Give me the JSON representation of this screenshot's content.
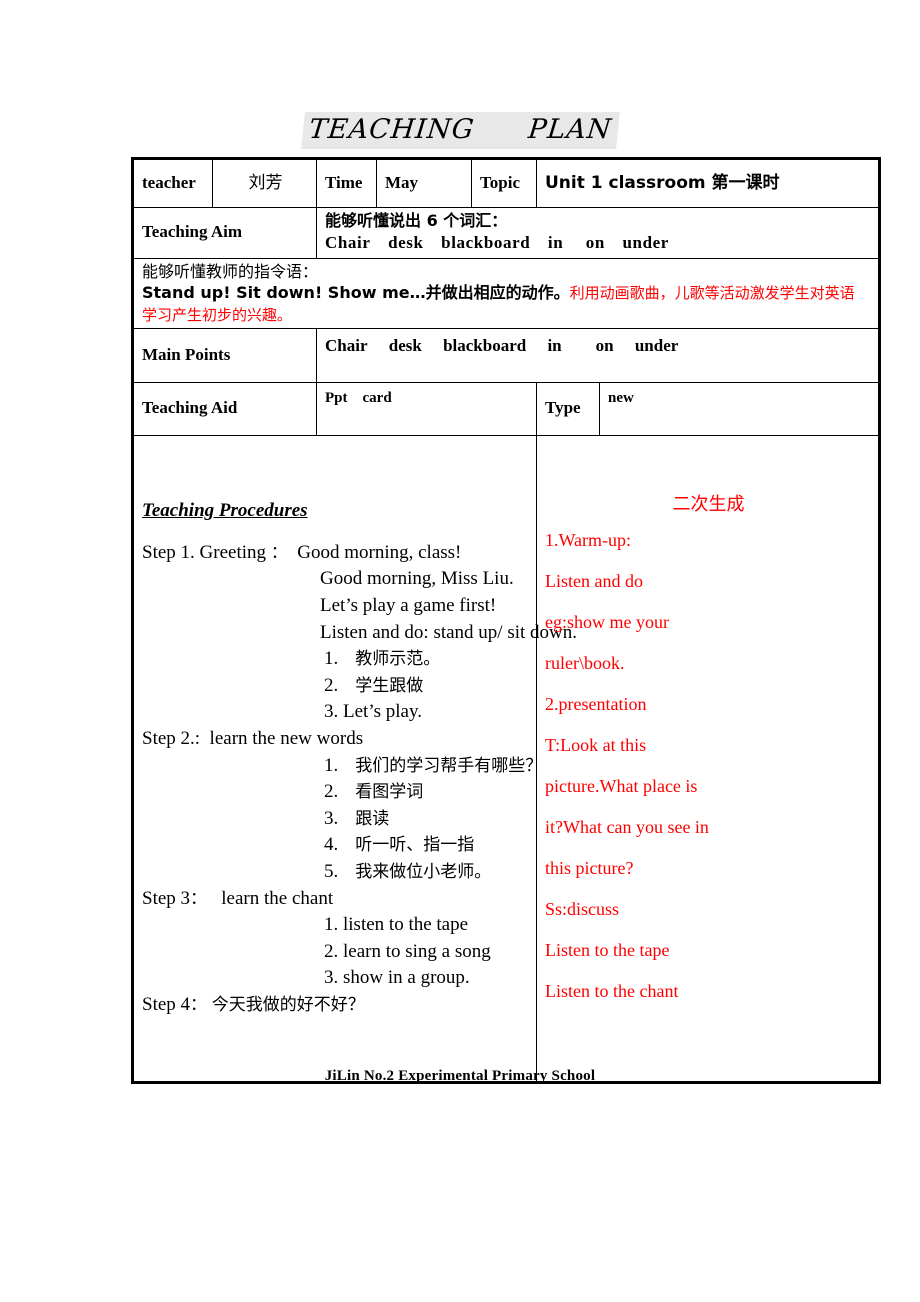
{
  "document": {
    "title_part1": "TEACHING",
    "title_part2": "PLAN",
    "footer": "JiLin No.2 Experimental Primary School",
    "accent_red": "#ff0000",
    "title_highlight": "#e8e8e8"
  },
  "info_row": {
    "teacher_label": "teacher",
    "teacher_value": "刘芳",
    "time_label": "Time",
    "time_value": "May",
    "topic_label": "Topic",
    "topic_value": "Unit 1 classroom 第一课时"
  },
  "teaching_aim": {
    "label": "Teaching Aim",
    "line1": "能够听懂说出 6 个词汇：",
    "line2": "Chair desk blackboard in  on under"
  },
  "instruction_block": {
    "line1": "能够听懂教师的指令语：",
    "line2_black": "Stand up! Sit down! Show me…并做出相应的动作。",
    "line2_red": "利用动画歌曲，儿歌等活动激发学生对英语",
    "line3_red": "学习产生初步的兴趣。"
  },
  "main_points": {
    "label": "Main Points",
    "value": "Chair  desk  blackboard  in  on  under"
  },
  "teaching_aid": {
    "label": "Teaching Aid",
    "value": "Ppt card",
    "type_label": "Type",
    "type_value": "new"
  },
  "procedures": {
    "heading": "Teaching Procedures",
    "right_heading": "二次生成",
    "left_lines": [
      {
        "indent": 0,
        "text": "Step 1. Greeting ：  Good morning, class!"
      },
      {
        "indent": 1,
        "text": "Good morning, Miss Liu."
      },
      {
        "indent": 1,
        "text": "Let’s play a game first!"
      },
      {
        "indent": 1,
        "text": "Listen and do: stand up/ sit down."
      },
      {
        "indent": 2,
        "text": "1.　教师示范。"
      },
      {
        "indent": 2,
        "text": "2.　学生跟做"
      },
      {
        "indent": 2,
        "text": "3. Let’s play."
      },
      {
        "indent": 0,
        "text": "Step 2.:  learn the new words"
      },
      {
        "indent": 2,
        "text": "1.　我们的学习帮手有哪些？"
      },
      {
        "indent": 2,
        "text": "2.　看图学词"
      },
      {
        "indent": 2,
        "text": "3.　跟读"
      },
      {
        "indent": 2,
        "text": "4.　听一听、指一指"
      },
      {
        "indent": 2,
        "text": "5.　我来做位小老师。"
      },
      {
        "indent": 0,
        "text": "Step 3：   learn the chant"
      },
      {
        "indent": 2,
        "text": "1. listen to the tape"
      },
      {
        "indent": 2,
        "text": "2. learn to sing a song"
      },
      {
        "indent": 2,
        "text": "3. show in a group."
      },
      {
        "indent": 0,
        "text": "Step 4： 今天我做的好不好？"
      }
    ],
    "right_lines": [
      "1.Warm-up:",
      "Listen and do",
      "eg:show me your",
      "ruler\\book.",
      "2.presentation",
      "T:Look at this",
      "picture.What place is",
      "it?What can you see in",
      "this picture?",
      "Ss:discuss",
      "Listen to the tape",
      "Listen to the chant"
    ]
  }
}
